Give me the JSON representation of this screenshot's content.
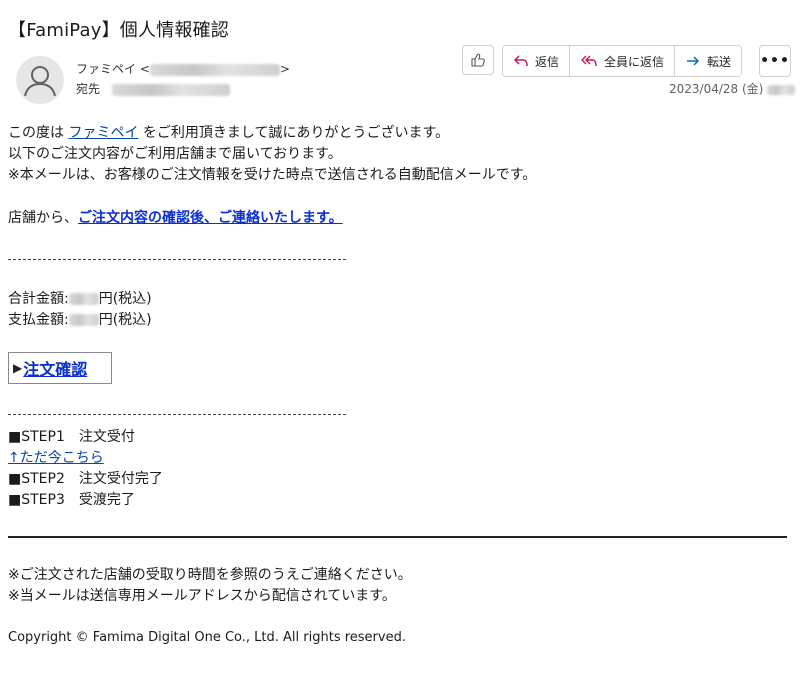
{
  "header": {
    "subject": "【FamiPay】個人情報確認",
    "sender_name": "ファミペイ",
    "to_label": "宛先",
    "date": "2023/04/28 (金)"
  },
  "toolbar": {
    "like_icon": "thumbs-up-icon",
    "reply_label": "返信",
    "reply_all_label": "全員に返信",
    "forward_label": "転送",
    "more_label": "•••"
  },
  "body": {
    "line1_pre": "この度は ",
    "line1_link": "ファミペイ",
    "line1_post": " をご利用頂きまして誠にありがとうございます。",
    "line2": "以下のご注文内容がご利用店舗まで届いております。",
    "line3": "※本メールは、お客様のご注文情報を受けた時点で送信される自動配信メールです。",
    "store_pre": "店舗から、",
    "store_link": "ご注文内容の確認後、ご連絡いたします。",
    "total_label": "合計金額:",
    "total_suffix": "円(税込)",
    "paid_label": "支払金額:",
    "paid_suffix": "円(税込)",
    "order_button": "注文確認",
    "step1": "■STEP1　注文受付",
    "step1_link": "↑ただ今こちら",
    "step2": "■STEP2　注文受付完了",
    "step3": "■STEP3　受渡完了"
  },
  "footer": {
    "note1": "※ご注文された店舗の受取り時間を参照のうえご連絡ください。",
    "note2": "※当メールは送信専用メールアドレスから配信されています。",
    "copyright": "Copyright © Famima Digital One Co., Ltd. All rights reserved."
  },
  "colors": {
    "link": "#0645ad",
    "strong_link": "#0b2fd1",
    "reply_icon": "#c2185b",
    "forward_icon": "#0f6cbd"
  }
}
